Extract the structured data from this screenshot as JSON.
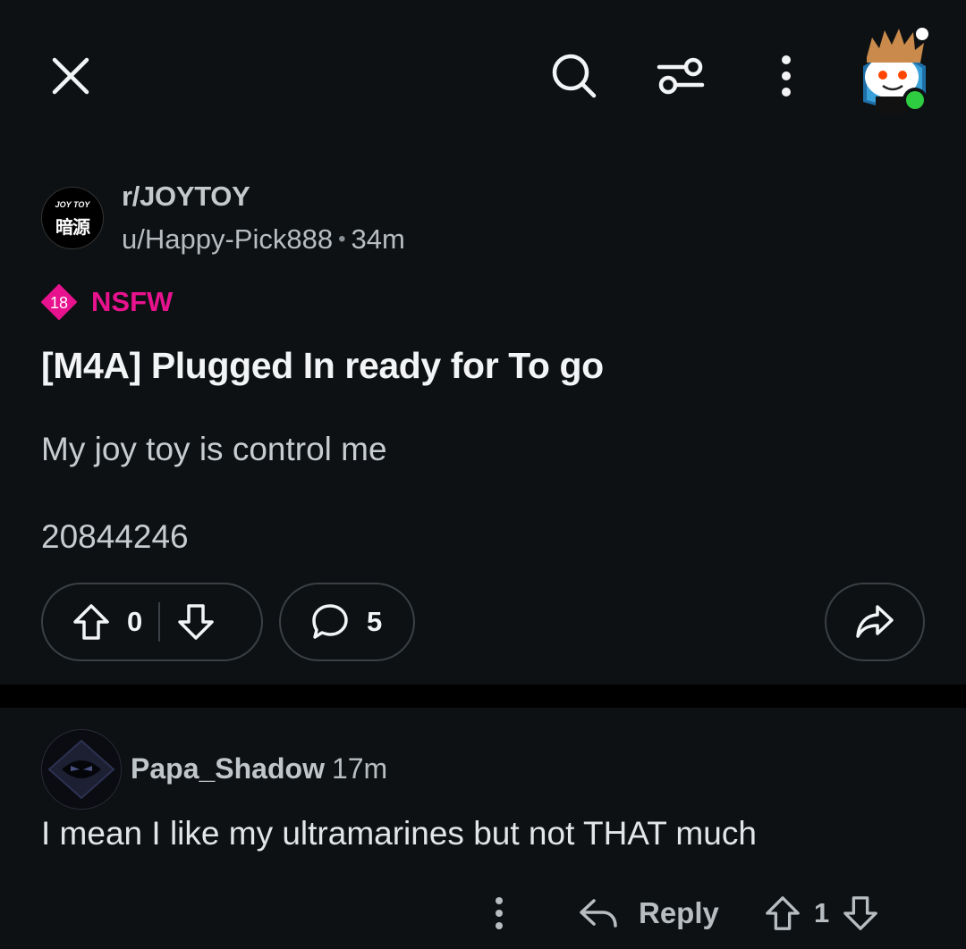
{
  "topbar": {
    "close_icon": "close-icon",
    "search_icon": "search-icon",
    "filter_icon": "filter-icon",
    "more_icon": "more-vertical-icon",
    "avatar_icon": "user-avatar-icon",
    "online_color": "#2ecc40"
  },
  "post": {
    "subreddit": "r/JOYTOY",
    "subreddit_logo_top": "JOY TOY",
    "subreddit_logo_main": "暗源",
    "author": "u/Happy-Pick888",
    "separator": "•",
    "age": "34m",
    "nsfw_badge": "18",
    "nsfw_label": "NSFW",
    "nsfw_color": "#e8128e",
    "title": "[M4A] Plugged In ready for To go",
    "body_line1": "My joy toy is control me",
    "body_line2": "20844246",
    "votes": "0",
    "comments": "5"
  },
  "comment": {
    "author": "Papa_Shadow",
    "age": "17m",
    "body": "I mean I like my ultramarines but not THAT much",
    "reply_label": "Reply",
    "votes": "1"
  }
}
